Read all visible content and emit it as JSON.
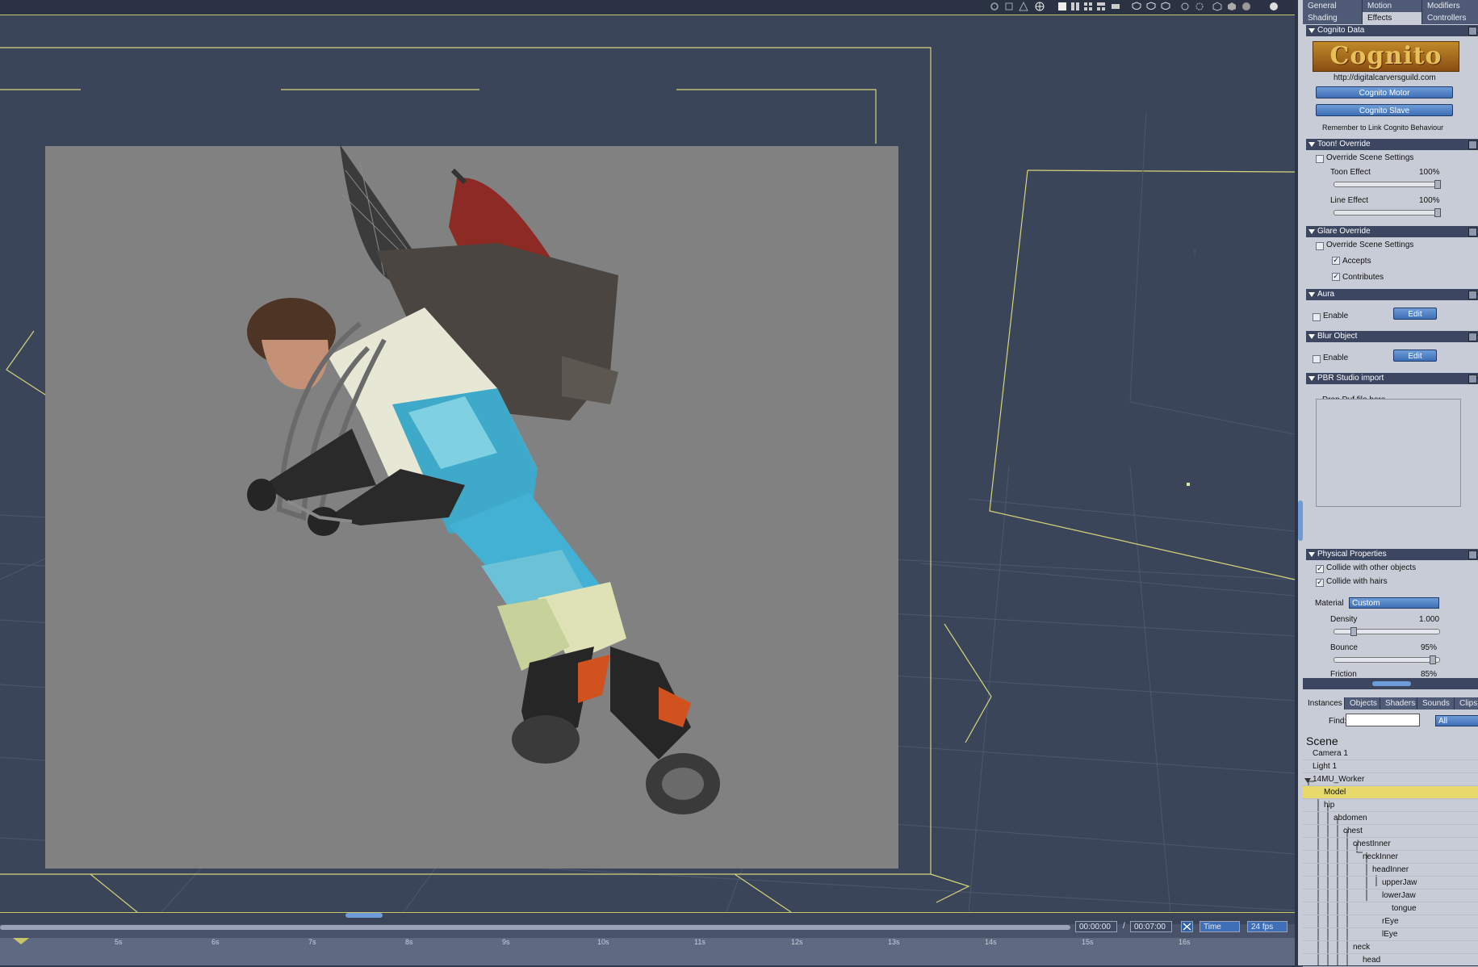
{
  "tabs_row1": [
    "General",
    "Motion",
    "Modifiers"
  ],
  "tabs_row2": [
    "Shading",
    "Effects",
    "Controllers"
  ],
  "active_tab": "Effects",
  "cognito": {
    "header": "Cognito Data",
    "logo_text": "Cognito",
    "url": "http://digitalcarversguild.com",
    "motor_button": "Cognito Motor",
    "slave_button": "Cognito Slave",
    "note": "Remember to Link Cognito Behaviour"
  },
  "toon": {
    "header": "Toon! Override",
    "override_label": "Override Scene Settings",
    "override_checked": false,
    "toon_effect_label": "Toon Effect",
    "toon_effect_value": "100%",
    "line_effect_label": "Line Effect",
    "line_effect_value": "100%"
  },
  "glare": {
    "header": "Glare Override",
    "override_label": "Override Scene Settings",
    "accepts_label": "Accepts",
    "contributes_label": "Contributes"
  },
  "aura": {
    "header": "Aura",
    "enable_label": "Enable",
    "edit_button": "Edit"
  },
  "blur": {
    "header": "Blur Object",
    "enable_label": "Enable",
    "edit_button": "Edit"
  },
  "pbr": {
    "header": "PBR Studio import",
    "drop_label": "Drop Duf file here"
  },
  "physical": {
    "header": "Physical Properties",
    "collide_objects_label": "Collide with other objects",
    "collide_hairs_label": "Collide with hairs",
    "material_label": "Material",
    "material_value": "Custom",
    "density_label": "Density",
    "density_value": "1.000",
    "bounce_label": "Bounce",
    "bounce_value": "95%",
    "friction_label": "Friction",
    "friction_value": "85%"
  },
  "browser_tabs": [
    "Instances",
    "Objects",
    "Shaders",
    "Sounds",
    "Clips"
  ],
  "find_label": "Find:",
  "find_value": "",
  "filter_value": "All",
  "scene_title": "Scene",
  "tree": [
    {
      "label": "Camera 1",
      "depth": 0
    },
    {
      "label": "Light 1",
      "depth": 0
    },
    {
      "label": "14MU_Worker",
      "depth": 0,
      "expanded": true
    },
    {
      "label": "Model",
      "depth": 1,
      "selected": true
    },
    {
      "label": "hip",
      "depth": 1,
      "expanded": true
    },
    {
      "label": "abdomen",
      "depth": 2,
      "expanded": true
    },
    {
      "label": "chest",
      "depth": 3,
      "expanded": true
    },
    {
      "label": "chestInner",
      "depth": 4,
      "expanded": true
    },
    {
      "label": "neckInner",
      "depth": 5,
      "expanded": true
    },
    {
      "label": "headInner",
      "depth": 6,
      "expanded": true
    },
    {
      "label": "upperJaw",
      "depth": 7
    },
    {
      "label": "lowerJaw",
      "depth": 7,
      "expanded": true
    },
    {
      "label": "tongue",
      "depth": 8
    },
    {
      "label": "rEye",
      "depth": 7
    },
    {
      "label": "lEye",
      "depth": 7
    },
    {
      "label": "neck",
      "depth": 4,
      "expanded": true
    },
    {
      "label": "head",
      "depth": 5
    }
  ],
  "timeline": {
    "current_time": "00:00:00",
    "separator": "/",
    "end_time": "00:07:00",
    "mode": "Time",
    "fps": "24 fps",
    "ticks": [
      "5s",
      "6s",
      "7s",
      "8s",
      "9s",
      "10s",
      "11s",
      "12s",
      "13s",
      "14s",
      "15s",
      "16s"
    ]
  },
  "colors": {
    "viewport_bg": "#3a4559",
    "render_bg": "#818181",
    "panel_bg": "#c7ccd6",
    "accent_blue": "#4f82c8",
    "selection_yellow": "#e8d96c",
    "guide_yellow": "#d8d47a"
  }
}
